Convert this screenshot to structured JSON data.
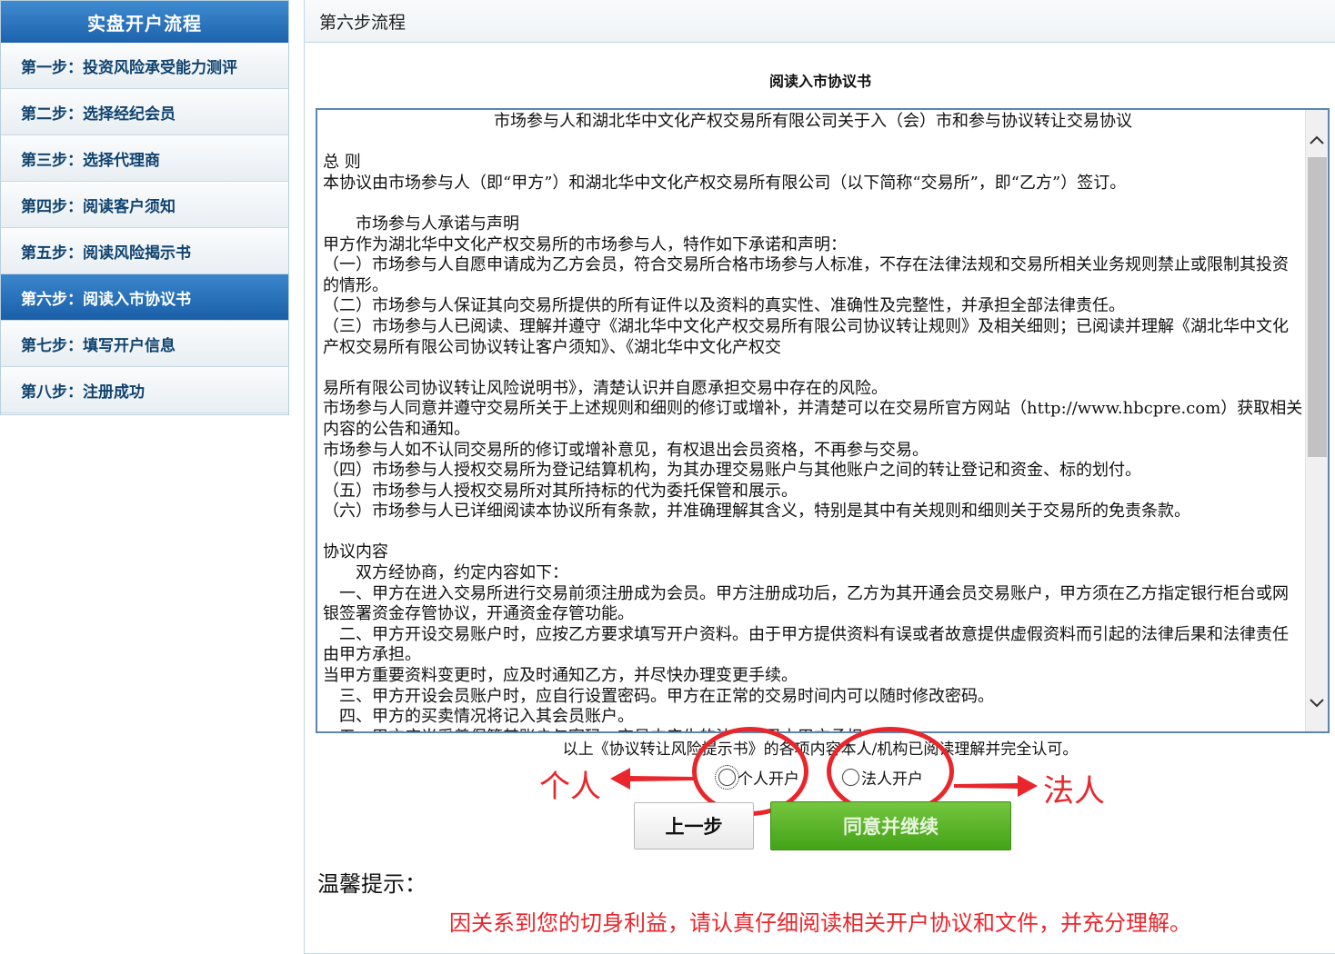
{
  "sidebar": {
    "title": "实盘开户流程",
    "items": [
      {
        "label": "第一步：投资风险承受能力测评",
        "active": false
      },
      {
        "label": "第二步：选择经纪会员",
        "active": false
      },
      {
        "label": "第三步：选择代理商",
        "active": false
      },
      {
        "label": "第四步：阅读客户须知",
        "active": false
      },
      {
        "label": "第五步：阅读风险揭示书",
        "active": false
      },
      {
        "label": "第六步：阅读入市协议书",
        "active": true
      },
      {
        "label": "第七步：填写开户信息",
        "active": false
      },
      {
        "label": "第八步：注册成功",
        "active": false
      }
    ]
  },
  "main": {
    "header": "第六步流程",
    "agreement_title": "阅读入市协议书",
    "document": {
      "title": "市场参与人和湖北华中文化产权交易所有限公司关于入（会）市和参与协议转让交易协议",
      "lines": [
        "",
        "总  则",
        "本协议由市场参与人（即“甲方”）和湖北华中文化产权交易所有限公司（以下简称“交易所”，即“乙方”）签订。",
        "",
        "　　市场参与人承诺与声明",
        "甲方作为湖北华中文化产权交易所的市场参与人，特作如下承诺和声明：",
        "（一）市场参与人自愿申请成为乙方会员，符合交易所合格市场参与人标准，不存在法律法规和交易所相关业务规则禁止或限制其投资的情形。",
        "（二）市场参与人保证其向交易所提供的所有证件以及资料的真实性、准确性及完整性，并承担全部法律责任。",
        "（三）市场参与人已阅读、理解并遵守《湖北华中文化产权交易所有限公司协议转让规则》及相关细则；已阅读并理解《湖北华中文化产权交易所有限公司协议转让客户须知》、《湖北华中文化产权交",
        "",
        "易所有限公司协议转让风险说明书》，清楚认识并自愿承担交易中存在的风险。",
        "市场参与人同意并遵守交易所关于上述规则和细则的修订或增补，并清楚可以在交易所官方网站（http://www.hbcpre.com）获取相关内容的公告和通知。",
        "市场参与人如不认同交易所的修订或增补意见，有权退出会员资格，不再参与交易。",
        "（四）市场参与人授权交易所为登记结算机构，为其办理交易账户与其他账户之间的转让登记和资金、标的划付。",
        "（五）市场参与人授权交易所对其所持标的代为委托保管和展示。",
        "（六）市场参与人已详细阅读本协议所有条款，并准确理解其含义，特别是其中有关规则和细则关于交易所的免责条款。",
        "",
        "协议内容",
        "　　双方经协商，约定内容如下：",
        "　一、甲方在进入交易所进行交易前须注册成为会员。甲方注册成功后，乙方为其开通会员交易账户，甲方须在乙方指定银行柜台或网银签署资金存管协议，开通资金存管功能。",
        "　二、甲方开设交易账户时，应按乙方要求填写开户资料。由于甲方提供资料有误或者故意提供虚假资料而引起的法律后果和法律责任由甲方承担。",
        "当甲方重要资料变更时，应及时通知乙方，并尽快办理变更手续。",
        "　三、甲方开设会员账户时，应自行设置密码。甲方在正常的交易时间内可以随时修改密码。",
        "　四、甲方的买卖情况将记入其会员账户。",
        "　五、甲方应当妥善保管其账户与密码，交易中产生的法律后果由甲方承担。"
      ]
    },
    "confirm_text": "以上《协议转让风险提示书》的各项内容本人/机构已阅读理解并完全认可。",
    "radio_personal": "个人开户",
    "radio_corporate": "法人开户",
    "annotation_personal": "个人",
    "annotation_corporate": "法人",
    "btn_prev": "上一步",
    "btn_next": "同意并继续",
    "tips_title": "温馨提示：",
    "tips_text": "因关系到您的切身利益，请认真仔细阅读相关开户协议和文件，并充分理解。"
  },
  "colors": {
    "sidebar_active": "#1d62ad",
    "annotation_red": "#e8262c",
    "next_button_green": "#52ab28"
  },
  "icons": {
    "scroll_up": "chevron-up-icon",
    "scroll_down": "chevron-down-icon"
  }
}
